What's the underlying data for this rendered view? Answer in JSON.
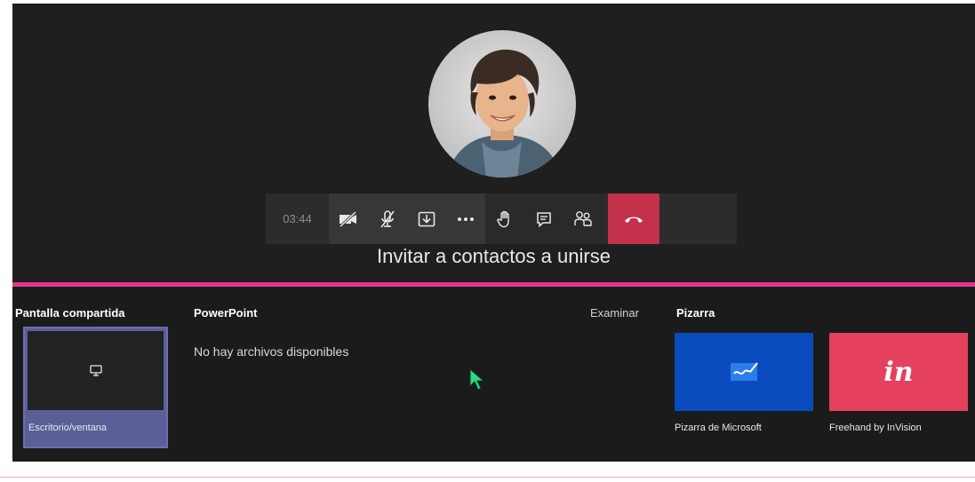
{
  "call": {
    "timer": "03:44",
    "invite_text": "Invitar a contactos a unirse"
  },
  "controls": {
    "icons": [
      "camera-off-icon",
      "mic-off-icon",
      "share-tray-icon",
      "more-icon",
      "raise-hand-icon",
      "chat-icon",
      "participants-icon",
      "hang-up-icon"
    ]
  },
  "tray": {
    "shared_screen": {
      "title": "Pantalla compartida",
      "item_label": "Escritorio/ventana"
    },
    "powerpoint": {
      "title": "PowerPoint",
      "browse": "Examinar",
      "empty_text": "No hay archivos disponibles"
    },
    "whiteboard": {
      "title": "Pizarra",
      "items": [
        {
          "label": "Pizarra de Microsoft"
        },
        {
          "label": "Freehand by InVision",
          "logo_text": "in"
        }
      ]
    }
  },
  "colors": {
    "hangup": "#c4314b",
    "accent_divider": "#e3368d",
    "selected_card": "#5b5f97",
    "ms_whiteboard": "#0a4cbd",
    "invision": "#e5405e"
  }
}
